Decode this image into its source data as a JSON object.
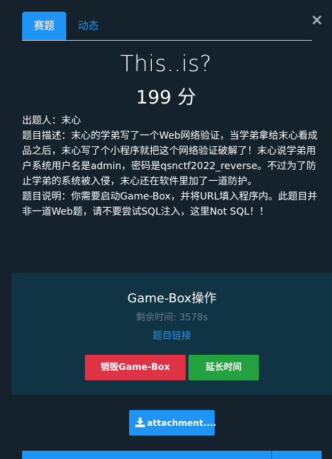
{
  "tabs": [
    {
      "label": "赛题",
      "active": true
    },
    {
      "label": "动态",
      "active": false
    }
  ],
  "close_glyph": "×",
  "challenge": {
    "name": "This..is?",
    "points": "199 分",
    "description_lines": [
      "出题人：末心",
      "题目描述：末心的学弟写了一个Web网络验证，当学弟拿给末心看成品之后，末心写了个小程序就把这个网络验证破解了！末心说学弟用户系统用户名是admin，密码是qsnctf2022_reverse。不过为了防止学弟的系统被入侵，末心还在软件里加了一道防护。",
      "题目说明：你需要启动Game-Box，并将URL填入程序内。此题目并非一道Web题，请不要尝试SQL注入，这里Not SQL！！"
    ]
  },
  "gamebox": {
    "title": "Game-Box操作",
    "remaining": "剩余时间: 3578s",
    "link_label": "题目链接",
    "destroy_label": "销毁Game-Box",
    "extend_label": "延长时间"
  },
  "attachment": {
    "label": "attachment...."
  },
  "colors": {
    "background": "#15222b",
    "accent": "#1e95f4",
    "panel": "#113444",
    "danger": "#de3344",
    "success": "#23a23f",
    "muted": "#6c7e89"
  },
  "icons": {
    "close": "close-icon",
    "download": "download-icon"
  }
}
